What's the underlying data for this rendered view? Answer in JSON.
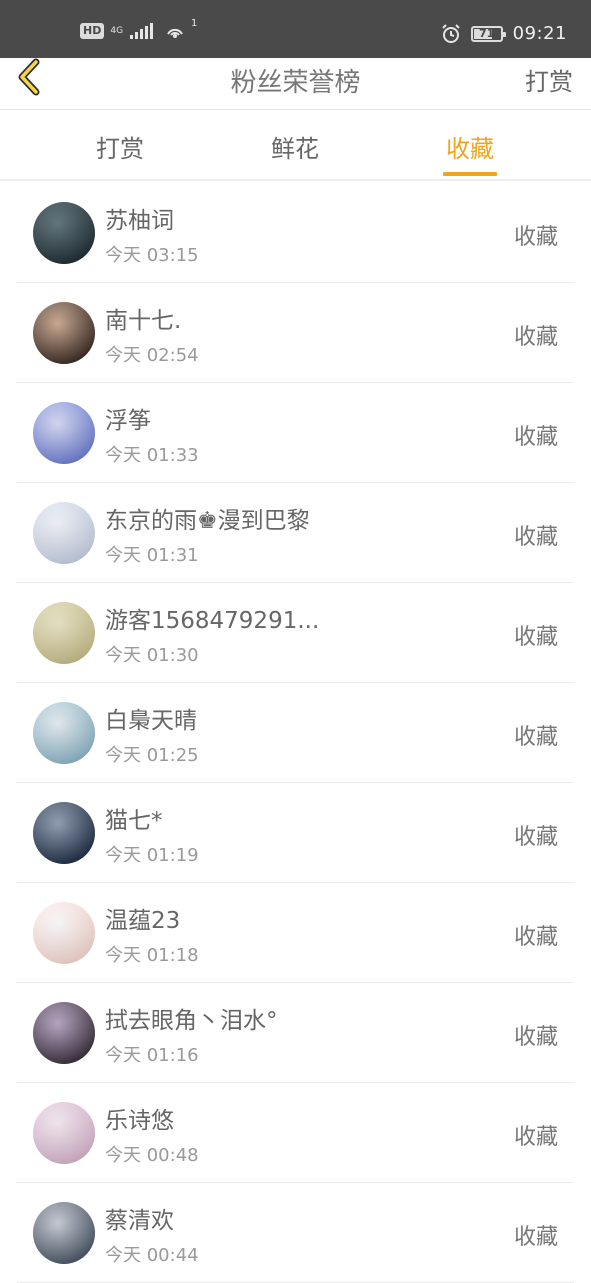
{
  "status_bar": {
    "hd": "HD",
    "net_type": "4G",
    "hotspot_count": "1",
    "battery": "71",
    "battery_level": 0.71,
    "time": "09:21"
  },
  "header": {
    "title": "粉丝荣誉榜",
    "action_label": "打赏"
  },
  "tabs": [
    {
      "label": "打赏",
      "active": false
    },
    {
      "label": "鲜花",
      "active": false
    },
    {
      "label": "收藏",
      "active": true
    }
  ],
  "colors": {
    "accent": "#f0a51c",
    "status_bar": "#4a4a4a"
  },
  "list": [
    {
      "name": "苏柚词",
      "time": "今天 03:15",
      "action": "收藏",
      "avatar_colors": [
        "#1d2b33",
        "#556b74"
      ]
    },
    {
      "name": "南十七.",
      "time": "今天 02:54",
      "action": "收藏",
      "avatar_colors": [
        "#3b2a22",
        "#caa78c"
      ]
    },
    {
      "name": "浮筝",
      "time": "今天 01:33",
      "action": "收藏",
      "avatar_colors": [
        "#6f7fd6",
        "#d6dbf5"
      ]
    },
    {
      "name": "东京的雨♚漫到巴黎",
      "time": "今天 01:31",
      "action": "收藏",
      "avatar_colors": [
        "#c8d3e6",
        "#f4f6fb"
      ]
    },
    {
      "name": "游客1568479291...",
      "time": "今天 01:30",
      "action": "收藏",
      "avatar_colors": [
        "#c9c08a",
        "#eae5c6"
      ]
    },
    {
      "name": "白梟天晴",
      "time": "今天 01:25",
      "action": "收藏",
      "avatar_colors": [
        "#8db7c9",
        "#e8eef3"
      ]
    },
    {
      "name": "猫七*",
      "time": "今天 01:19",
      "action": "收藏",
      "avatar_colors": [
        "#1f2d45",
        "#8a9ab1"
      ]
    },
    {
      "name": "温蕴23",
      "time": "今天 01:18",
      "action": "收藏",
      "avatar_colors": [
        "#f9d9d2",
        "#ffffff"
      ]
    },
    {
      "name": "拭去眼角丶泪水°",
      "time": "今天 01:16",
      "action": "收藏",
      "avatar_colors": [
        "#3a2f3d",
        "#b7a2c4"
      ]
    },
    {
      "name": "乐诗悠",
      "time": "今天 00:48",
      "action": "收藏",
      "avatar_colors": [
        "#d9b5d0",
        "#f7ecf3"
      ]
    },
    {
      "name": "蔡清欢",
      "time": "今天 00:44",
      "action": "收藏",
      "avatar_colors": [
        "#4a5566",
        "#c7ccd6"
      ]
    }
  ]
}
